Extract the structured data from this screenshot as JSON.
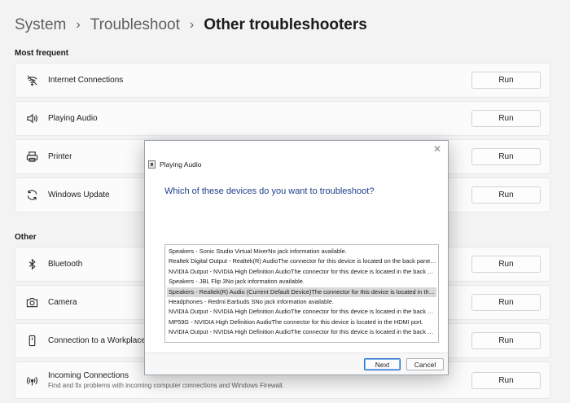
{
  "breadcrumb": {
    "items": [
      "System",
      "Troubleshoot",
      "Other troubleshooters"
    ],
    "separator": "›"
  },
  "sections": {
    "most_frequent": "Most frequent",
    "other": "Other"
  },
  "run_label": "Run",
  "rows": [
    {
      "title": "Internet Connections",
      "icon": "wifi-icon"
    },
    {
      "title": "Playing Audio",
      "icon": "speaker-icon"
    },
    {
      "title": "Printer",
      "icon": "printer-icon"
    },
    {
      "title": "Windows Update",
      "icon": "refresh-icon"
    },
    {
      "title": "Bluetooth",
      "icon": "bluetooth-icon"
    },
    {
      "title": "Camera",
      "icon": "camera-icon"
    },
    {
      "title": "Connection to a Workplace Using DirectAccess",
      "icon": "device-icon"
    },
    {
      "title": "Incoming Connections",
      "description": "Find and fix problems with incoming computer connections and Windows Firewall.",
      "icon": "antenna-icon"
    }
  ],
  "dialog": {
    "title": "Playing Audio",
    "close": "✕",
    "question": "Which of these devices do you want to troubleshoot?",
    "devices": [
      "Speakers - Sonic Studio Virtual MixerNo jack information available.",
      "Realtek Digital Output - Realtek(R) AudioThe connector for this device is located on the back panel of the computer.",
      "NVIDIA Output - NVIDIA High Definition AudioThe connector for this device is located in the back panel.",
      "Speakers - JBL Flip 3No jack information available.",
      "Speakers - Realtek(R) Audio (Current Default Device)The connector for this device is located in the back panel.",
      "Headphones - Redmi Earbuds SNo jack information available.",
      "NVIDIA Output - NVIDIA High Definition AudioThe connector for this device is located in the back panel.",
      "MP59G - NVIDIA High Definition AudioThe connector for this device is located in the HDMI port.",
      "NVIDIA Output - NVIDIA High Definition AudioThe connector for this device is located in the back panel."
    ],
    "selected_index": 4,
    "next_label": "Next",
    "cancel_label": "Cancel"
  }
}
